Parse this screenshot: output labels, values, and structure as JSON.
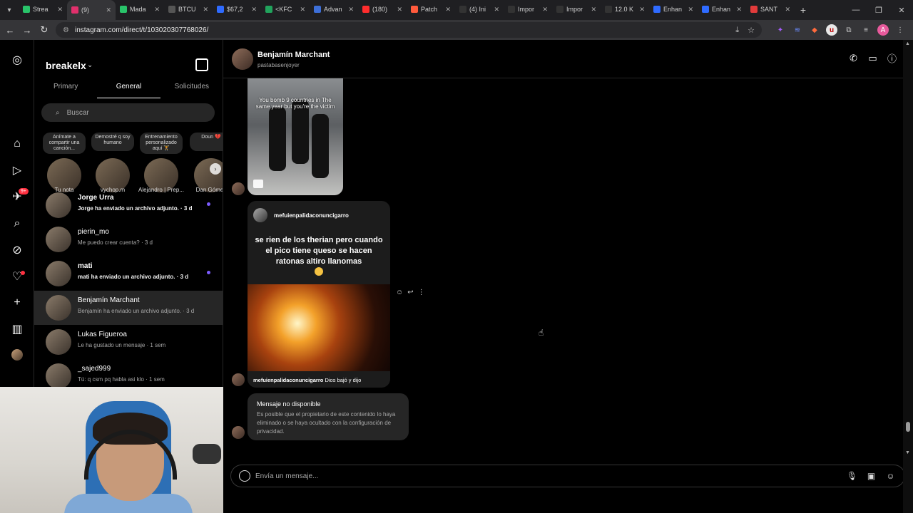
{
  "browser": {
    "tabs": [
      {
        "label": "Strea",
        "color": "#29c46a"
      },
      {
        "label": "(9)",
        "color": "#e1306c",
        "active": true
      },
      {
        "label": "Mada",
        "color": "#29c46a"
      },
      {
        "label": "BTCU",
        "color": "#555555"
      },
      {
        "label": "$67,2",
        "color": "#2f6bff"
      },
      {
        "label": "<KFC",
        "color": "#21a35c"
      },
      {
        "label": "Advan",
        "color": "#3d6fd8"
      },
      {
        "label": "(180)",
        "color": "#ff2d2d"
      },
      {
        "label": "Patch",
        "color": "#ff5a3c"
      },
      {
        "label": "(4) Ini",
        "color": "#333333"
      },
      {
        "label": "Impor",
        "color": "#333333"
      },
      {
        "label": "Impor",
        "color": "#333333"
      },
      {
        "label": "12.0 K",
        "color": "#333333"
      },
      {
        "label": "Enhan",
        "color": "#2f6bff"
      },
      {
        "label": "Enhan",
        "color": "#2f6bff"
      },
      {
        "label": "SANT",
        "color": "#e23b3b"
      }
    ],
    "url": "instagram.com/direct/t/103020307768026/"
  },
  "sidebar": {
    "account": "breakelx",
    "tabs": [
      "Primary",
      "General",
      "Solicitudes"
    ],
    "active_tab": "General",
    "search_placeholder": "Buscar",
    "notifications_badge": "9+",
    "notes": [
      {
        "bubble": "Anímate a compartir una canción...",
        "name": "Tu nota"
      },
      {
        "bubble": "Demostré q soy humano",
        "name": "vychop.m"
      },
      {
        "bubble": "Entrenamiento personalizado aquí 🏋",
        "name": "Alejandro | Prep..."
      },
      {
        "bubble": "Doun 💔",
        "name": "Dan Gómez"
      }
    ],
    "conversations": [
      {
        "name": "Jorge Urra",
        "preview": "Jorge ha enviado un archivo adjunto. · 3 d",
        "unread": true,
        "bold": true
      },
      {
        "name": "pierin_mo",
        "preview": "Me puedo crear cuenta? · 3 d",
        "unread": false,
        "bold": false
      },
      {
        "name": "mati",
        "preview": "mati ha enviado un archivo adjunto. · 3 d",
        "unread": true,
        "bold": true
      },
      {
        "name": "Benjamín Marchant",
        "preview": "Benjamín ha enviado un archivo adjunto. · 3 d",
        "unread": false,
        "bold": false,
        "selected": true
      },
      {
        "name": "Lukas Figueroa",
        "preview": "Le ha gustado un mensaje · 1 sem",
        "unread": false,
        "bold": false
      },
      {
        "name": "_sajed999",
        "preview": "Tú: q csm pq habla asi klo · 1 sem",
        "unread": false,
        "bold": false
      }
    ]
  },
  "chat": {
    "name": "Benjamín Marchant",
    "username": "pastabasenjoyer",
    "video_caption": "You bomb 9 countries in The same year but you're the victim",
    "post": {
      "author": "mefuienpalidaconuncigarro",
      "text": "se rien de los therian pero cuando el pico tiene queso se hacen ratonas altiro llanomas",
      "caption_author": "mefuienpalidaconuncigarro",
      "caption_text": "Dios bajó y dijo"
    },
    "unavailable_title": "Mensaje no disponible",
    "unavailable_body": "Es posible que el propietario de este contenido lo haya eliminado o se haya ocultado con la configuración de privacidad.",
    "composer_placeholder": "Envía un mensaje..."
  }
}
